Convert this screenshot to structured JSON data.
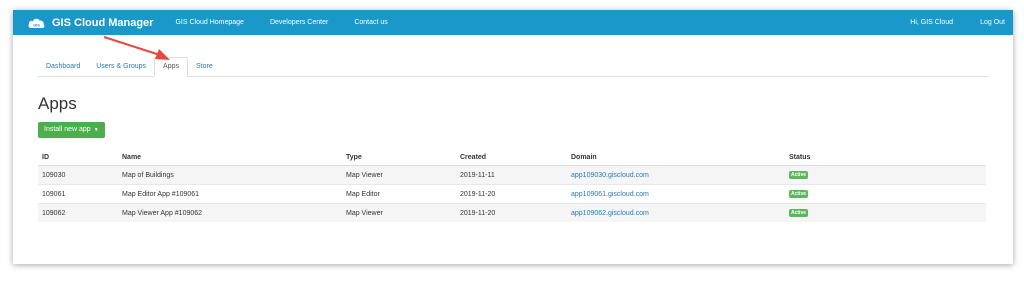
{
  "navbar": {
    "brand": "GIS Cloud Manager",
    "logo_text": "GIS",
    "links": [
      "GIS Cloud Homepage",
      "Developers Center",
      "Contact us"
    ],
    "greeting": "Hi, GIS Cloud",
    "logout": "Log Out",
    "color": "#1a98c9"
  },
  "tabs": [
    {
      "label": "Dashboard",
      "active": false
    },
    {
      "label": "Users & Groups",
      "active": false
    },
    {
      "label": "Apps",
      "active": true
    },
    {
      "label": "Store",
      "active": false
    }
  ],
  "page_title": "Apps",
  "install_button": "Install new app",
  "table": {
    "headers": [
      "ID",
      "Name",
      "Type",
      "Created",
      "Domain",
      "Status"
    ],
    "rows": [
      {
        "id": "109030",
        "name": "Map of Buildings",
        "type": "Map Viewer",
        "created": "2019-11-11",
        "domain": "app109030.giscloud.com",
        "status": "Active"
      },
      {
        "id": "109061",
        "name": "Map Editor App #109061",
        "type": "Map Editor",
        "created": "2019-11-20",
        "domain": "app109061.giscloud.com",
        "status": "Active"
      },
      {
        "id": "109062",
        "name": "Map Viewer App #109062",
        "type": "Map Viewer",
        "created": "2019-11-20",
        "domain": "app109062.giscloud.com",
        "status": "Active"
      }
    ]
  },
  "annotation_color": "#e8473b"
}
